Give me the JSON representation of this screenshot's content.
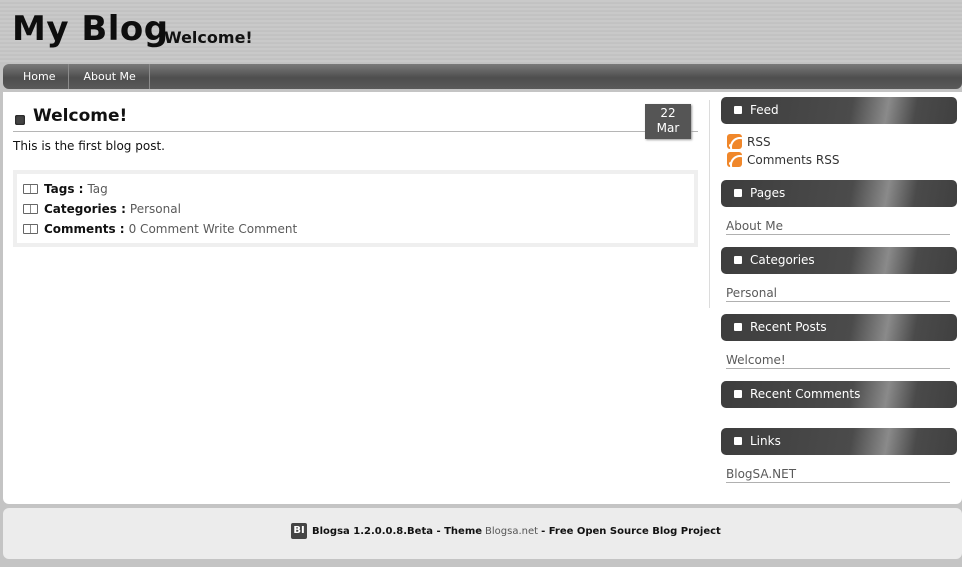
{
  "header": {
    "title": "My Blog",
    "tagline": "Welcome!"
  },
  "nav": {
    "items": [
      {
        "label": "Home"
      },
      {
        "label": "About Me"
      }
    ]
  },
  "post": {
    "title": "Welcome!",
    "date_day": "22",
    "date_month": "Mar",
    "body": "This is the first blog post.",
    "tags_label": "Tags :",
    "tags_value": "Tag",
    "categories_label": "Categories :",
    "categories_value": "Personal",
    "comments_label": "Comments :",
    "comments_count": "0 Comment",
    "write_comment": "Write Comment"
  },
  "sidebar": {
    "feed": {
      "title": "Feed",
      "rss": "RSS",
      "comments_rss": "Comments RSS",
      "icon": "rss-icon"
    },
    "pages": {
      "title": "Pages",
      "items": [
        "About Me"
      ]
    },
    "categories": {
      "title": "Categories",
      "items": [
        "Personal"
      ]
    },
    "recent_posts": {
      "title": "Recent Posts",
      "items": [
        "Welcome!"
      ]
    },
    "recent_comments": {
      "title": "Recent Comments"
    },
    "links": {
      "title": "Links",
      "items": [
        "BlogSA.NET"
      ]
    }
  },
  "footer": {
    "logo": "BI",
    "version": "Blogsa 1.2.0.0.8.Beta - Theme",
    "theme_link": "Blogsa.net",
    "suffix": "- Free Open Source Blog Project"
  },
  "colors": {
    "nav_bg": "#555555",
    "widget_header": "#444444",
    "rss_orange": "#f0872a",
    "link_gray": "#5a5a5a"
  }
}
